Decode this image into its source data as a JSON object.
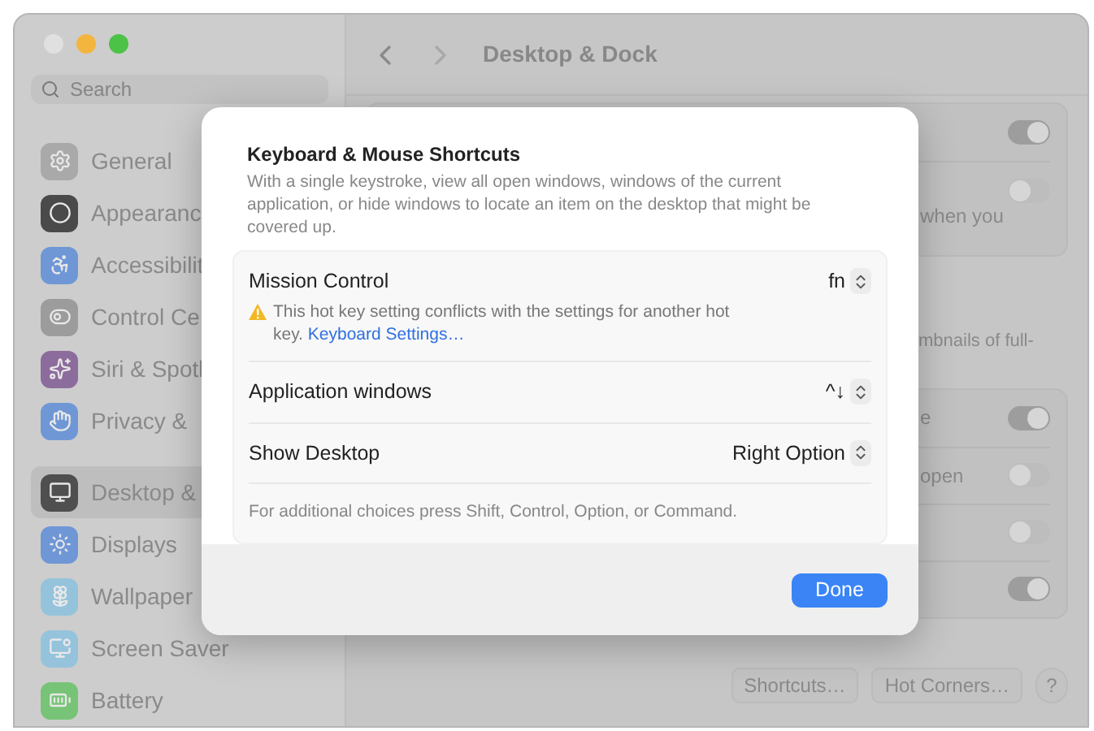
{
  "window": {
    "title": "Desktop & Dock",
    "traffic_lights": [
      {
        "color": "#e0e0e0"
      },
      {
        "color": "#f4b53f"
      },
      {
        "color": "#4cc247"
      }
    ]
  },
  "sidebar": {
    "search": {
      "placeholder": "Search"
    },
    "sections": [
      {
        "items": [
          {
            "label": "General",
            "color": "#a9a9a9",
            "selected": false
          },
          {
            "label": "Appearanc",
            "color": "#4a4a4a",
            "selected": false
          },
          {
            "label": "Accessibilit",
            "color": "#6f97d6",
            "selected": false
          },
          {
            "label": "Control Ce",
            "color": "#9c9c9c",
            "selected": false
          },
          {
            "label": "Siri & Spotl",
            "color": "#8c6c9c",
            "selected": false
          },
          {
            "label": "Privacy &",
            "color": "#6f97d6",
            "selected": false
          }
        ]
      },
      {
        "items": [
          {
            "label": "Desktop &",
            "color": "#4f4f4f",
            "selected": true
          },
          {
            "label": "Displays",
            "color": "#6f97d6",
            "selected": false
          },
          {
            "label": "Wallpaper",
            "color": "#95c3dc",
            "selected": false
          },
          {
            "label": "Screen Saver",
            "color": "#95c3dc",
            "selected": false
          },
          {
            "label": "Battery",
            "color": "#77c377",
            "selected": false
          }
        ]
      }
    ]
  },
  "content": {
    "cards": [
      {
        "rows": [
          {
            "text": "",
            "on": true
          },
          {
            "text": "when you",
            "on": false
          }
        ]
      },
      {
        "note": "mbnails of full-",
        "rows": [
          {
            "text": "e",
            "on": true
          },
          {
            "text": "open",
            "on": false
          },
          {
            "text": "",
            "on": false
          },
          {
            "text": "",
            "on": true
          }
        ]
      }
    ],
    "buttons": [
      "Shortcuts…",
      "Hot Corners…",
      "?"
    ]
  },
  "dialog": {
    "title": "Keyboard & Mouse Shortcuts",
    "description": "With a single keystroke, view all open windows, windows of the current application, or hide windows to locate an item on the desktop that might be covered up.",
    "shortcuts": [
      {
        "label": "Mission Control",
        "value": "fn",
        "warning": "This hot key setting conflicts with the settings for another hot key.",
        "link": "Keyboard Settings…"
      },
      {
        "label": "Application windows",
        "value": "^↓"
      },
      {
        "label": "Show Desktop",
        "value": "Right Option"
      }
    ],
    "footnote": "For additional choices press Shift, Control, Option, or Command.",
    "done": "Done"
  }
}
